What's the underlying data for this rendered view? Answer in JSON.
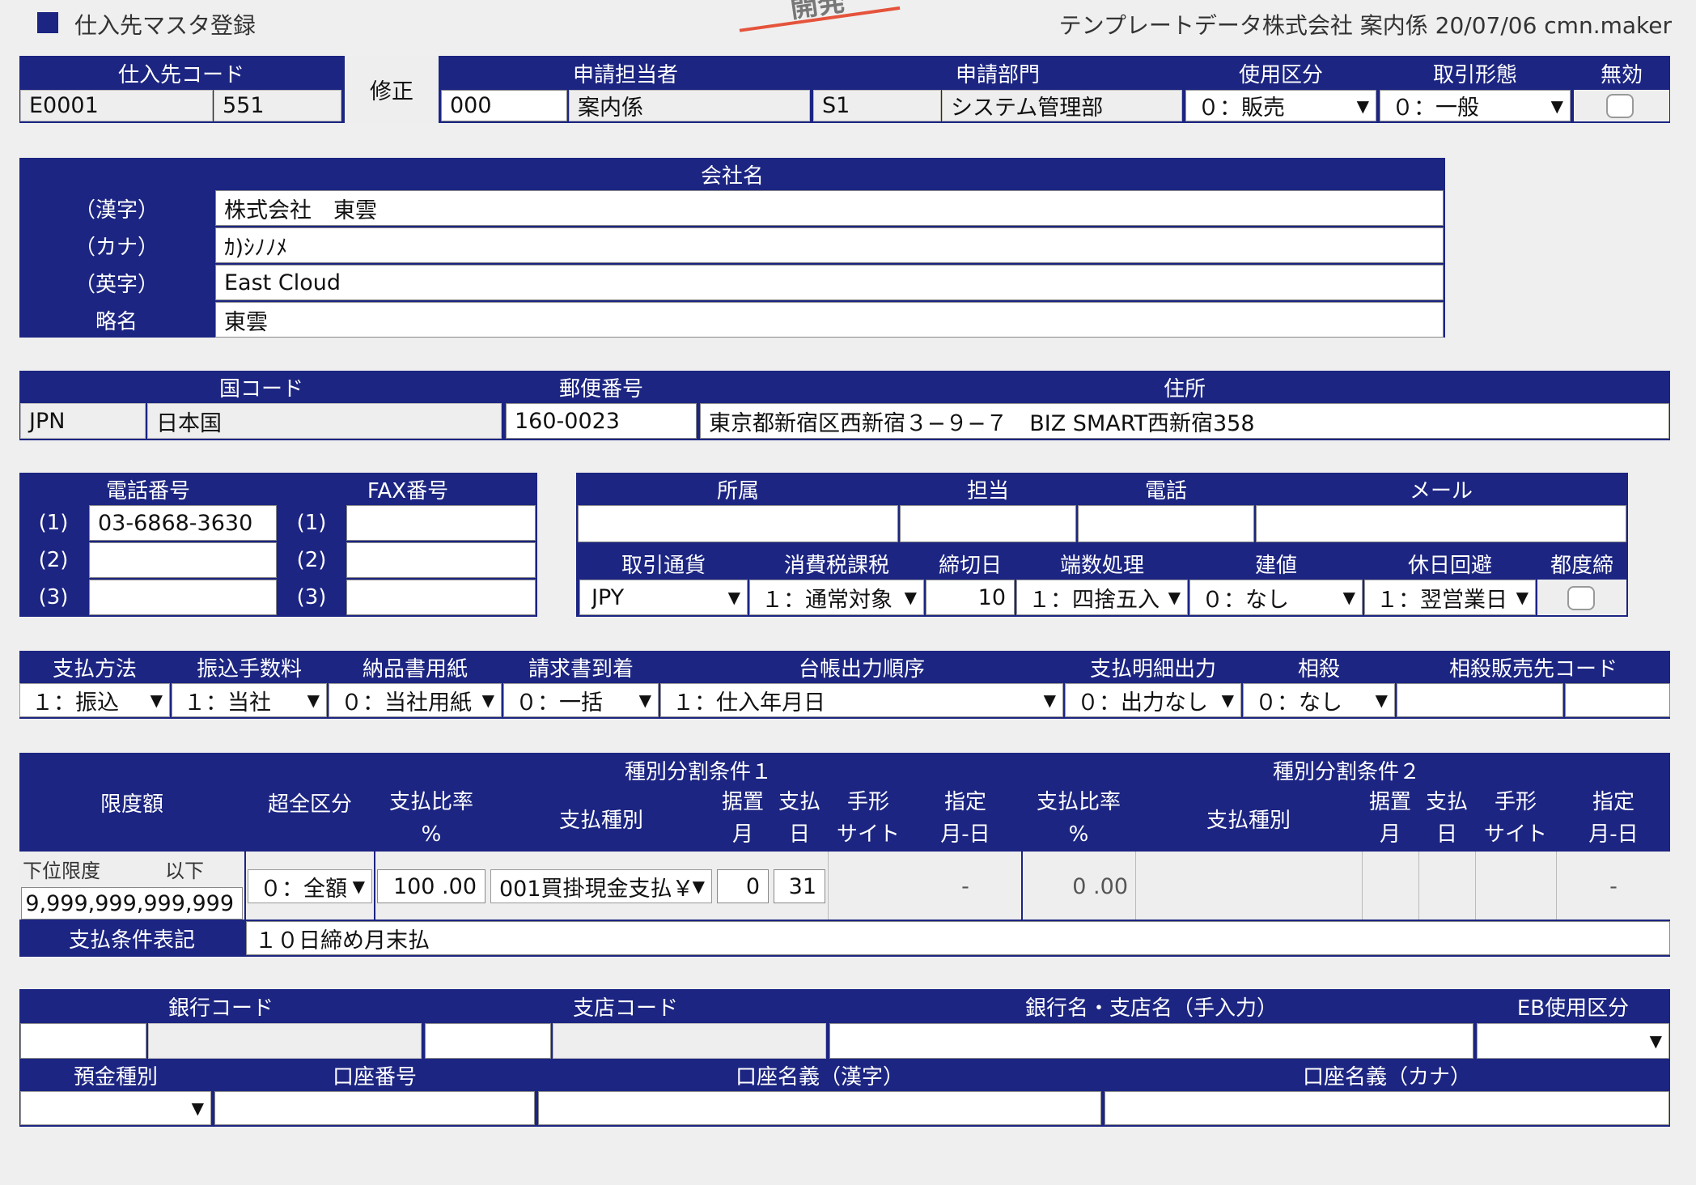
{
  "window": {
    "title": "仕入先マスタ登録",
    "stamp": "開発",
    "user_info": "テンプレートデータ株式会社 案内係 20/07/06 cmn.maker"
  },
  "top": {
    "h_supplier_code": "仕入先コード",
    "supplier_code": "E0001",
    "supplier_sub": "551",
    "mode_label": "修正",
    "h_applicant": "申請担当者",
    "applicant_code": "000",
    "applicant_name": "案内係",
    "h_dept": "申請部門",
    "dept_code": "S1",
    "dept_name": "システム管理部",
    "h_usage": "使用区分",
    "usage": "０：販売",
    "h_trade": "取引形態",
    "trade": "０：一般",
    "h_invalid": "無効"
  },
  "company": {
    "h_title": "会社名",
    "kanji_label": "（漢字）",
    "kanji": "株式会社　東雲",
    "kana_label": "（カナ）",
    "kana": "ｶ)ｼﾉﾉﾒ",
    "eng_label": "（英字）",
    "eng": "East Cloud",
    "short_label": "略名",
    "short": "東雲"
  },
  "address": {
    "h_country": "国コード",
    "country_code": "JPN",
    "country_name": "日本国",
    "h_zip": "郵便番号",
    "zip": "160-0023",
    "h_addr": "住所",
    "addr": "東京都新宿区西新宿３−９−７　BIZ SMART西新宿358"
  },
  "phones": {
    "h_tel": "電話番号",
    "h_fax": "FAX番号",
    "n1": "(1)",
    "n2": "(2)",
    "n3": "(3)",
    "tel1": "03-6868-3630",
    "tel2": "",
    "tel3": "",
    "fax1": "",
    "fax2": "",
    "fax3": ""
  },
  "contact": {
    "h_dept": "所属",
    "h_person": "担当",
    "h_tel": "電話",
    "h_mail": "メール",
    "dept": "",
    "person": "",
    "tel": "",
    "mail": ""
  },
  "trade": {
    "h_currency": "取引通貨",
    "currency": "JPY",
    "h_tax": "消費税課税",
    "tax": "１：通常対象",
    "h_cutoff": "締切日",
    "cutoff": "10",
    "h_round": "端数処理",
    "round": "１：四捨五入",
    "h_price": "建値",
    "price": "０：なし",
    "h_holiday": "休日回避",
    "holiday": "１：翌営業日",
    "h_each": "都度締"
  },
  "payment": {
    "h_method": "支払方法",
    "method": "１：振込",
    "h_fee": "振込手数料",
    "fee": "１：当社",
    "h_paper": "納品書用紙",
    "paper": "０：当社用紙",
    "h_invoice": "請求書到着",
    "invoice": "０：一括",
    "h_ledger": "台帳出力順序",
    "ledger": "１：仕入年月日",
    "h_detail": "支払明細出力",
    "detail": "０：出力なし",
    "h_offset": "相殺",
    "offset": "０：なし",
    "h_offset_code": "相殺販売先コード",
    "offset_code1": "",
    "offset_code2": ""
  },
  "limits": {
    "h_limit": "限度額",
    "h_over": "超全区分",
    "h_cond1": "種別分割条件１",
    "h_cond2": "種別分割条件２",
    "h_rate": "支払比率",
    "h_pct": "%",
    "h_kind": "支払種別",
    "h_defer": "据置",
    "h_month": "月",
    "h_pay": "支払",
    "h_day": "日",
    "h_bill": "手形",
    "h_site": "サイト",
    "h_spec": "指定",
    "h_md": "月-日",
    "lower_label": "下位限度",
    "below_label": "以下",
    "limit_value": "9,999,999,999,999",
    "over": "０：全額",
    "rate1": "100 .00",
    "kind1": "001買掛現金支払￥",
    "defer1": "0",
    "pay1": "31",
    "spec1": "-",
    "rate2": "0 .00",
    "spec2": "-",
    "h_terms": "支払条件表記",
    "terms": "１０日締め月末払"
  },
  "bank": {
    "h_bank_code": "銀行コード",
    "h_branch_code": "支店コード",
    "h_bank_name": "銀行名・支店名（手入力）",
    "h_eb": "EB使用区分",
    "h_deposit": "預金種別",
    "h_account": "口座番号",
    "h_holder_kanji": "口座名義（漢字）",
    "h_holder_kana": "口座名義（カナ）",
    "bank_code": "",
    "branch_code": "",
    "bank_name": "",
    "eb": "",
    "deposit": "",
    "account": "",
    "holder_kanji": "",
    "holder_kana": ""
  },
  "colors": {
    "header_bg": "#1c2582",
    "page_bg": "#efefef",
    "stamp_line": "#e5533b"
  },
  "icons": {
    "title_marker": "square-icon",
    "dropdown": "triangle-down-icon",
    "checkbox": "checkbox-icon"
  }
}
